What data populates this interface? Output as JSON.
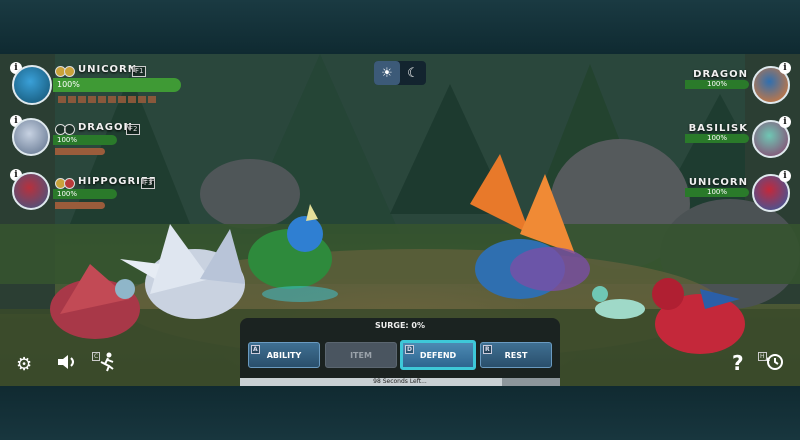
{
  "theme_toggle": {
    "light_icon": "gear-sun-icon",
    "dark_icon": "moon-icon"
  },
  "player_team": [
    {
      "name": "UNICORN",
      "hotkey": "F1",
      "hp": "100%",
      "hp_fraction": 1.0,
      "active": true
    },
    {
      "name": "DRAGON",
      "hotkey": "F2",
      "hp": "100%",
      "hp_fraction": 1.0,
      "active": false
    },
    {
      "name": "HIPPOGRIFF",
      "hotkey": "F3",
      "hp": "100%",
      "hp_fraction": 1.0,
      "active": false
    }
  ],
  "enemy_team": [
    {
      "name": "DRAGON",
      "hp": "100%",
      "hp_fraction": 1.0
    },
    {
      "name": "BASILISK",
      "hp": "100%",
      "hp_fraction": 1.0
    },
    {
      "name": "UNICORN",
      "hp": "100%",
      "hp_fraction": 1.0
    }
  ],
  "info_label": "i",
  "action_panel": {
    "surge": "SURGE: 0%",
    "buttons": [
      {
        "key": "A",
        "label": "ABILITY",
        "state": "enabled"
      },
      {
        "key": "",
        "label": "ITEM",
        "state": "disabled"
      },
      {
        "key": "D",
        "label": "DEFEND",
        "state": "selected"
      },
      {
        "key": "R",
        "label": "REST",
        "state": "enabled"
      }
    ],
    "timer_text": "98 Seconds Left...",
    "timer_fraction": 0.82
  },
  "controls": {
    "settings_icon": "gear-icon",
    "sound_icon": "speaker-icon",
    "flee_icon": "running-icon",
    "flee_key": "C",
    "help_label": "?",
    "history_icon": "history-icon",
    "history_key": "H"
  }
}
